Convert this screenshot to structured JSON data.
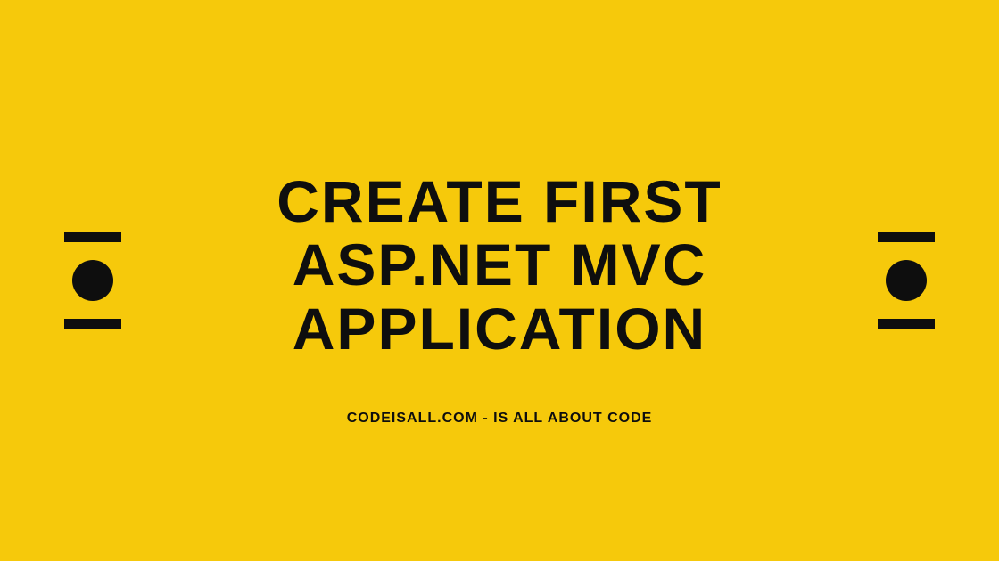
{
  "title": "CREATE FIRST ASP.NET MVC APPLICATION",
  "subtitle": "CODEISALL.COM - IS ALL ABOUT CODE",
  "colors": {
    "background": "#f6c90b",
    "text": "#0e0e0e"
  }
}
